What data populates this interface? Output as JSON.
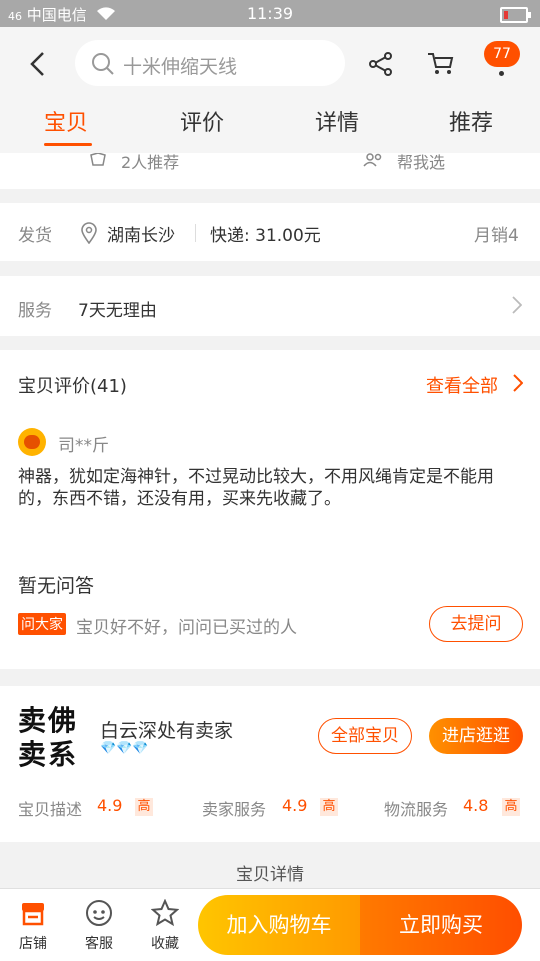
{
  "status": {
    "carrier": "中国电信",
    "signal": "46",
    "time": "11:39"
  },
  "header": {
    "search_placeholder": "十米伸缩天线",
    "cart_badge": "77",
    "tabs": [
      {
        "label": "宝贝",
        "active": true
      },
      {
        "label": "评价"
      },
      {
        "label": "详情"
      },
      {
        "label": "推荐"
      }
    ]
  },
  "recommend": {
    "count_text": "2人推荐",
    "help_text": "帮我选"
  },
  "shipping": {
    "label": "发货",
    "location": "湖南长沙",
    "express": "快递: 31.00元",
    "monthly_sales": "月销4"
  },
  "service": {
    "label": "服务",
    "value": "7天无理由"
  },
  "reviews": {
    "title": "宝贝评价(41)",
    "view_all": "查看全部",
    "user": "司**斤",
    "text": "神器，犹如定海神针，不过晃动比较大，不用风绳肯定是不能用的，东西不错，还没有用，买来先收藏了。"
  },
  "qa": {
    "title": "暂无问答",
    "tag": "问大家",
    "prompt": "宝贝好不好，问问已买过的人",
    "ask_button": "去提问"
  },
  "shop": {
    "logo_text": "卖佛卖系",
    "name": "白云深处有卖家",
    "diamonds": "💎💎💎",
    "all_items_button": "全部宝贝",
    "visit_button": "进店逛逛",
    "ratings": [
      {
        "label": "宝贝描述",
        "score": "4.9",
        "level": "高"
      },
      {
        "label": "卖家服务",
        "score": "4.9",
        "level": "高"
      },
      {
        "label": "物流服务",
        "score": "4.8",
        "level": "高"
      }
    ]
  },
  "detail_header": "宝贝详情",
  "bottom": {
    "shop": "店铺",
    "service": "客服",
    "favorite": "收藏",
    "add_cart": "加入购物车",
    "buy_now": "立即购买"
  }
}
